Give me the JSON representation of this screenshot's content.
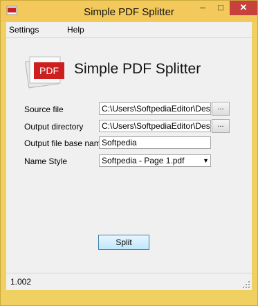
{
  "window": {
    "title": "Simple PDF Splitter",
    "icon": "pdf-app-icon",
    "controls": {
      "minimize": "–",
      "maximize": "□",
      "close": "✕"
    }
  },
  "menu": {
    "items": [
      "Settings",
      "Help"
    ]
  },
  "header": {
    "logo_text": "PDF",
    "app_title": "Simple PDF Splitter"
  },
  "form": {
    "source_file": {
      "label": "Source file",
      "value": "C:\\Users\\SoftpediaEditor\\Desktop",
      "browse": "..."
    },
    "output_directory": {
      "label": "Output directory",
      "value": "C:\\Users\\SoftpediaEditor\\Desktop",
      "browse": "..."
    },
    "base_name": {
      "label": "Output file base name",
      "value": "Softpedia"
    },
    "name_style": {
      "label": "Name Style",
      "value": "Softpedia - Page 1.pdf"
    }
  },
  "actions": {
    "split": "Split"
  },
  "status": {
    "version": "1.002"
  },
  "colors": {
    "frame": "#f2c95a",
    "close": "#c7423d",
    "logo_red": "#cc1f1f"
  }
}
